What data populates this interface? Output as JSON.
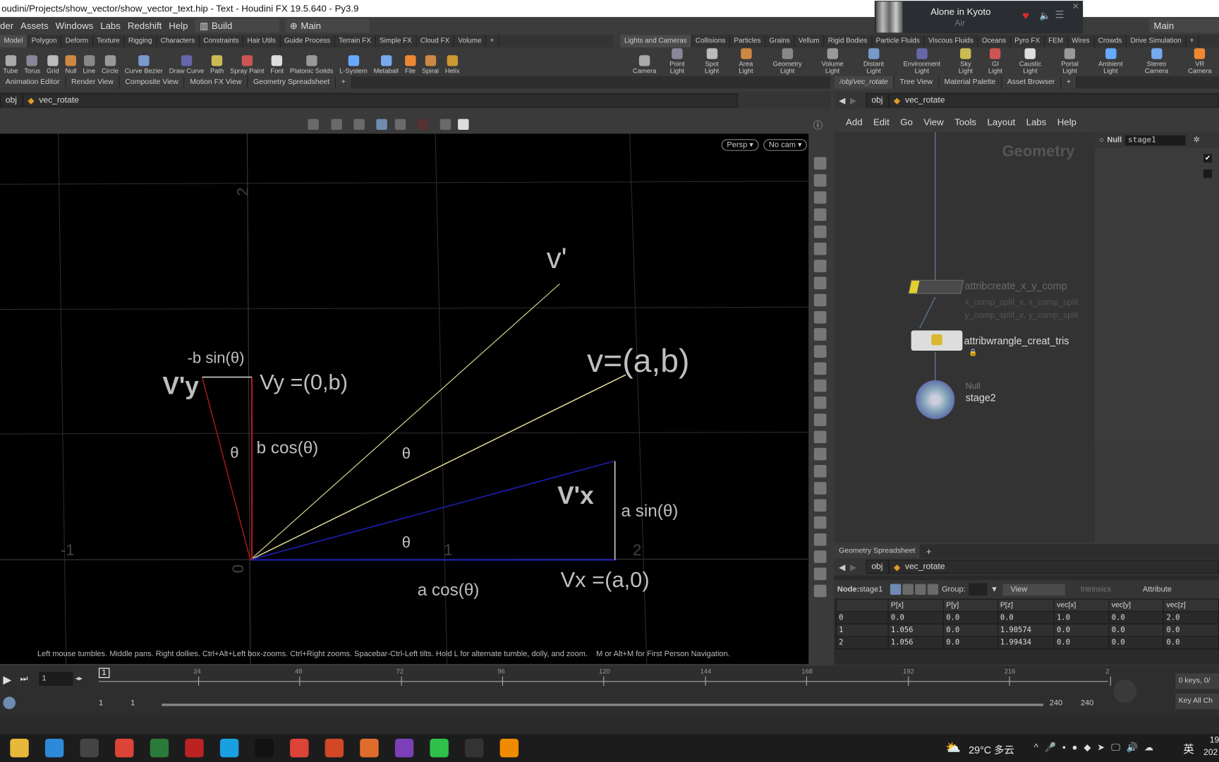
{
  "window": {
    "title": "oudini/Projects/show_vector/show_vector_text.hip - Text - Houdini FX 19.5.640 - Py3.9"
  },
  "menu": [
    "der",
    "Assets",
    "Windows",
    "Labs",
    "Redshift",
    "Help"
  ],
  "desktop": {
    "label": "Build",
    "viewer": "Main",
    "right_desktop": "Main"
  },
  "media": {
    "song": "Alone in Kyoto",
    "artist": "Air"
  },
  "shelf_left": {
    "tabs": [
      "Model",
      "Polygon",
      "Deform",
      "Texture",
      "Rigging",
      "Characters",
      "Constraints",
      "Hair Utils",
      "Guide Process",
      "Terrain FX",
      "Simple FX",
      "Cloud FX",
      "Volume",
      "+"
    ],
    "tools": [
      "Tube",
      "Torus",
      "Grid",
      "Null",
      "Line",
      "Circle",
      "Curve Bezier",
      "Draw Curve",
      "Path",
      "Spray Paint",
      "Font",
      "Platonic Solids",
      "L-System",
      "Metaball",
      "File",
      "Spiral",
      "Helix"
    ]
  },
  "shelf_right": {
    "tabs": [
      "Lights and Cameras",
      "Collisions",
      "Particles",
      "Grains",
      "Vellum",
      "Rigid Bodies",
      "Particle Fluids",
      "Viscous Fluids",
      "Oceans",
      "Pyro FX",
      "FEM",
      "Wires",
      "Crowds",
      "Drive Simulation",
      "+"
    ],
    "tools": [
      "Camera",
      "Point Light",
      "Spot Light",
      "Area Light",
      "Geometry Light",
      "Volume Light",
      "Distant Light",
      "Environment Light",
      "Sky Light",
      "GI Light",
      "Caustic Light",
      "Portal Light",
      "Ambient Light",
      "Stereo Camera",
      "VR Camera"
    ]
  },
  "left_panes": [
    "Animation Editor",
    "Render View",
    "Composite View",
    "Motion FX View",
    "Geometry Spreadsheet",
    "+"
  ],
  "right_panes": [
    "/obj/vec_rotate",
    "Tree View",
    "Material Palette",
    "Asset Browser",
    "+"
  ],
  "path": {
    "root": "obj",
    "node": "vec_rotate"
  },
  "viewport": {
    "persp": "Persp ▾",
    "cam": "No cam ▾",
    "axis_labels": {
      "xm1": "-1",
      "x0": "0",
      "x1": "1",
      "x2": "2",
      "y2": "2"
    },
    "labels": {
      "vprime": "v'",
      "v": "v=(a,b)",
      "neg_b_sin": "-b sin(θ)",
      "vy_prime": "V'y",
      "vy": "Vy =(0,b)",
      "theta_top": "θ",
      "b_cos": "b cos(θ)",
      "theta_mid": "θ",
      "theta_low": "θ",
      "vx_prime": "V'x",
      "a_sin": "a sin(θ)",
      "a_cos": "a cos(θ)",
      "vx": "Vx =(a,0)"
    },
    "hint": "Left mouse tumbles. Middle pans. Right dollies. Ctrl+Alt+Left box-zooms. Ctrl+Right zooms. Spacebar-Ctrl-Left tilts. Hold L for alternate tumble, dolly, and zoom.    M or Alt+M for First Person Navigation."
  },
  "colors": {
    "vector": "#e8e39a",
    "blue": "#1d1db0",
    "red": "#b01818",
    "node_yellow": "#e3cf2e"
  },
  "network": {
    "menu": [
      "Add",
      "Edit",
      "Go",
      "View",
      "Tools",
      "Layout",
      "Labs",
      "Help"
    ],
    "context": "Geometry",
    "nodes": {
      "attribcreate": "attribcreate_x_y_comp",
      "attribcreate_info1": "x_comp_split_x, x_comp_split",
      "attribcreate_info2": "y_comp_split_x, y_comp_split",
      "wrangle": "attribwrangle_creat_tris",
      "null_type": "Null",
      "null_name": "stage2"
    }
  },
  "parms": {
    "type": "Null",
    "name": "stage1"
  },
  "spreadsheet": {
    "tab": "Geometry Spreadsheet",
    "node_label": "Node:",
    "node": "stage1",
    "group": "Group:",
    "view": "View",
    "intrinsics": "Intrinsics",
    "attributes": "Attribute",
    "columns": [
      "",
      "P[x]",
      "P[y]",
      "P[z]",
      "vec[x]",
      "vec[y]",
      "vec[z]"
    ],
    "rows": [
      [
        "0",
        "0.0",
        "0.0",
        "0.0",
        "1.0",
        "0.0",
        "2.0"
      ],
      [
        "1",
        "1.056",
        "0.0",
        "1.90574",
        "0.0",
        "0.0",
        "0.0"
      ],
      [
        "2",
        "1.056",
        "0.0",
        "1.99434",
        "0.0",
        "0.0",
        "0.0"
      ]
    ]
  },
  "timeline": {
    "frame": "1",
    "marker": "1",
    "ticks": [
      "24",
      "48",
      "72",
      "96",
      "120",
      "144",
      "168",
      "192",
      "216",
      "2"
    ],
    "start": "1",
    "start2": "1",
    "end": "240",
    "end2": "240",
    "keys": "0 keys, 0/",
    "key_all": "Key All Ch"
  },
  "taskbar": {
    "apps": [
      "file-explorer",
      "mail",
      "terminal",
      "chrome",
      "monitor",
      "mega",
      "app-blue",
      "nitro",
      "chrome-2",
      "powerpoint",
      "houdini",
      "onenote",
      "wechat",
      "obs",
      "vlc"
    ],
    "weather": "29°C 多云",
    "ime": "英",
    "clock": "19",
    "date": "202"
  }
}
